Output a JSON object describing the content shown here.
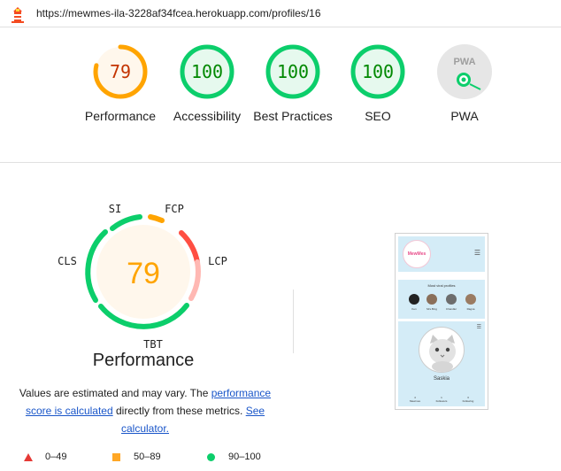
{
  "browser": {
    "url": "https://mewmes-ila-3228af34fcea.herokuapp.com/profiles/16"
  },
  "summary": {
    "gauges": [
      {
        "key": "performance",
        "score": "79",
        "label": "Performance",
        "color": "#ffa400",
        "fraction": 0.79
      },
      {
        "key": "accessibility",
        "score": "100",
        "label": "Accessibility",
        "color": "#0cce6b",
        "fraction": 1.0
      },
      {
        "key": "best-practices",
        "score": "100",
        "label": "Best Practices",
        "color": "#0cce6b",
        "fraction": 1.0
      },
      {
        "key": "seo",
        "score": "100",
        "label": "SEO",
        "color": "#0cce6b",
        "fraction": 1.0
      },
      {
        "key": "pwa",
        "score": "PWA",
        "label": "PWA",
        "color": "#9e9e9e",
        "fraction": 0
      }
    ]
  },
  "performance": {
    "score": "79",
    "title": "Performance",
    "metrics": {
      "si": "SI",
      "fcp": "FCP",
      "lcp": "LCP",
      "tbt": "TBT",
      "cls": "CLS"
    },
    "desc_text_1": "Values are estimated and may vary. The ",
    "desc_link_1": "performance score is calculated",
    "desc_text_2": " directly from these metrics. ",
    "desc_link_2": "See calculator."
  },
  "legend": {
    "fail": "0–49",
    "average": "50–89",
    "pass": "90–100",
    "colors": {
      "fail": "#e53935",
      "average": "#ffa726",
      "pass": "#0cce6b"
    }
  },
  "thumbnail": {
    "logo_text": "MewMes",
    "viral_title": "Most viral profiles",
    "viral_names": [
      "Ken",
      "Mrs.Bing",
      "Chandler",
      "Ragna"
    ],
    "profile_name": "Saskia",
    "stats": [
      {
        "value": "4",
        "label": "Mewmes"
      },
      {
        "value": "1",
        "label": "Followers"
      },
      {
        "value": "3",
        "label": "Following"
      }
    ]
  }
}
